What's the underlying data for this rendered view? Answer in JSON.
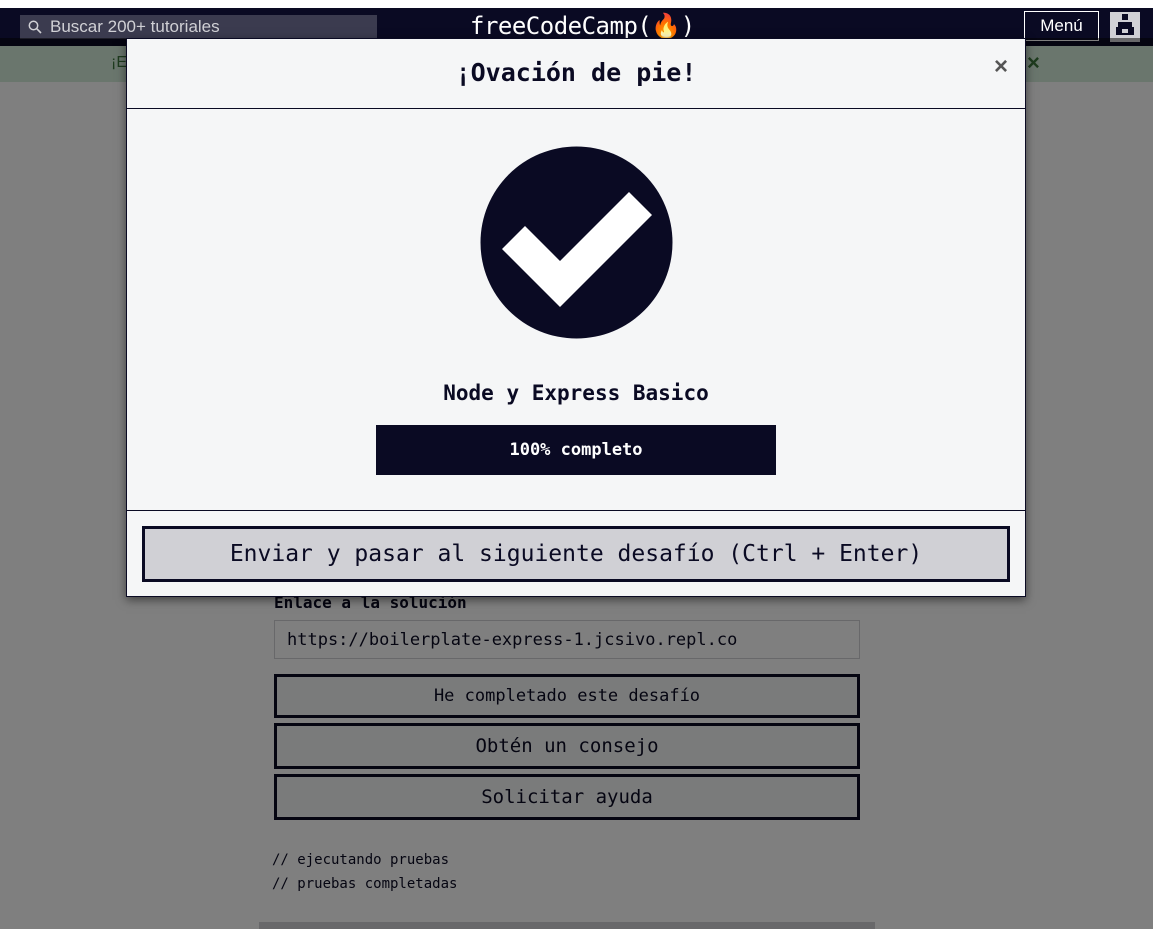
{
  "navbar": {
    "search_placeholder": "Buscar 200+ tutoriales",
    "brand": "freeCodeCamp(🔥)",
    "menu_label": "Menú"
  },
  "banner": {
    "text": "¡E",
    "close": "×"
  },
  "page": {
    "solution_label": "Enlace a la solución",
    "solution_value": "https://boilerplate-express-1.jcsivo.repl.co",
    "buttons": {
      "complete": "He completado este desafío",
      "hint": "Obtén un consejo",
      "help": "Solicitar ayuda"
    },
    "console_lines": [
      "// ejecutando pruebas",
      "// pruebas completadas"
    ]
  },
  "modal": {
    "title": "¡Ovación de pie!",
    "close": "×",
    "course_title": "Node y Express Basico",
    "progress_percent": 100,
    "progress_label": "100% completo",
    "submit_label": "Enviar y pasar al siguiente desafío (Ctrl + Enter)"
  },
  "colors": {
    "primary": "#0a0a23",
    "background": "#f5f6f7",
    "accent_gray": "#d0d0d5",
    "success_banner": "#d4edda"
  },
  "icons": {
    "search": "search-icon",
    "avatar": "avatar-icon",
    "success": "checkmark-circle-icon"
  }
}
